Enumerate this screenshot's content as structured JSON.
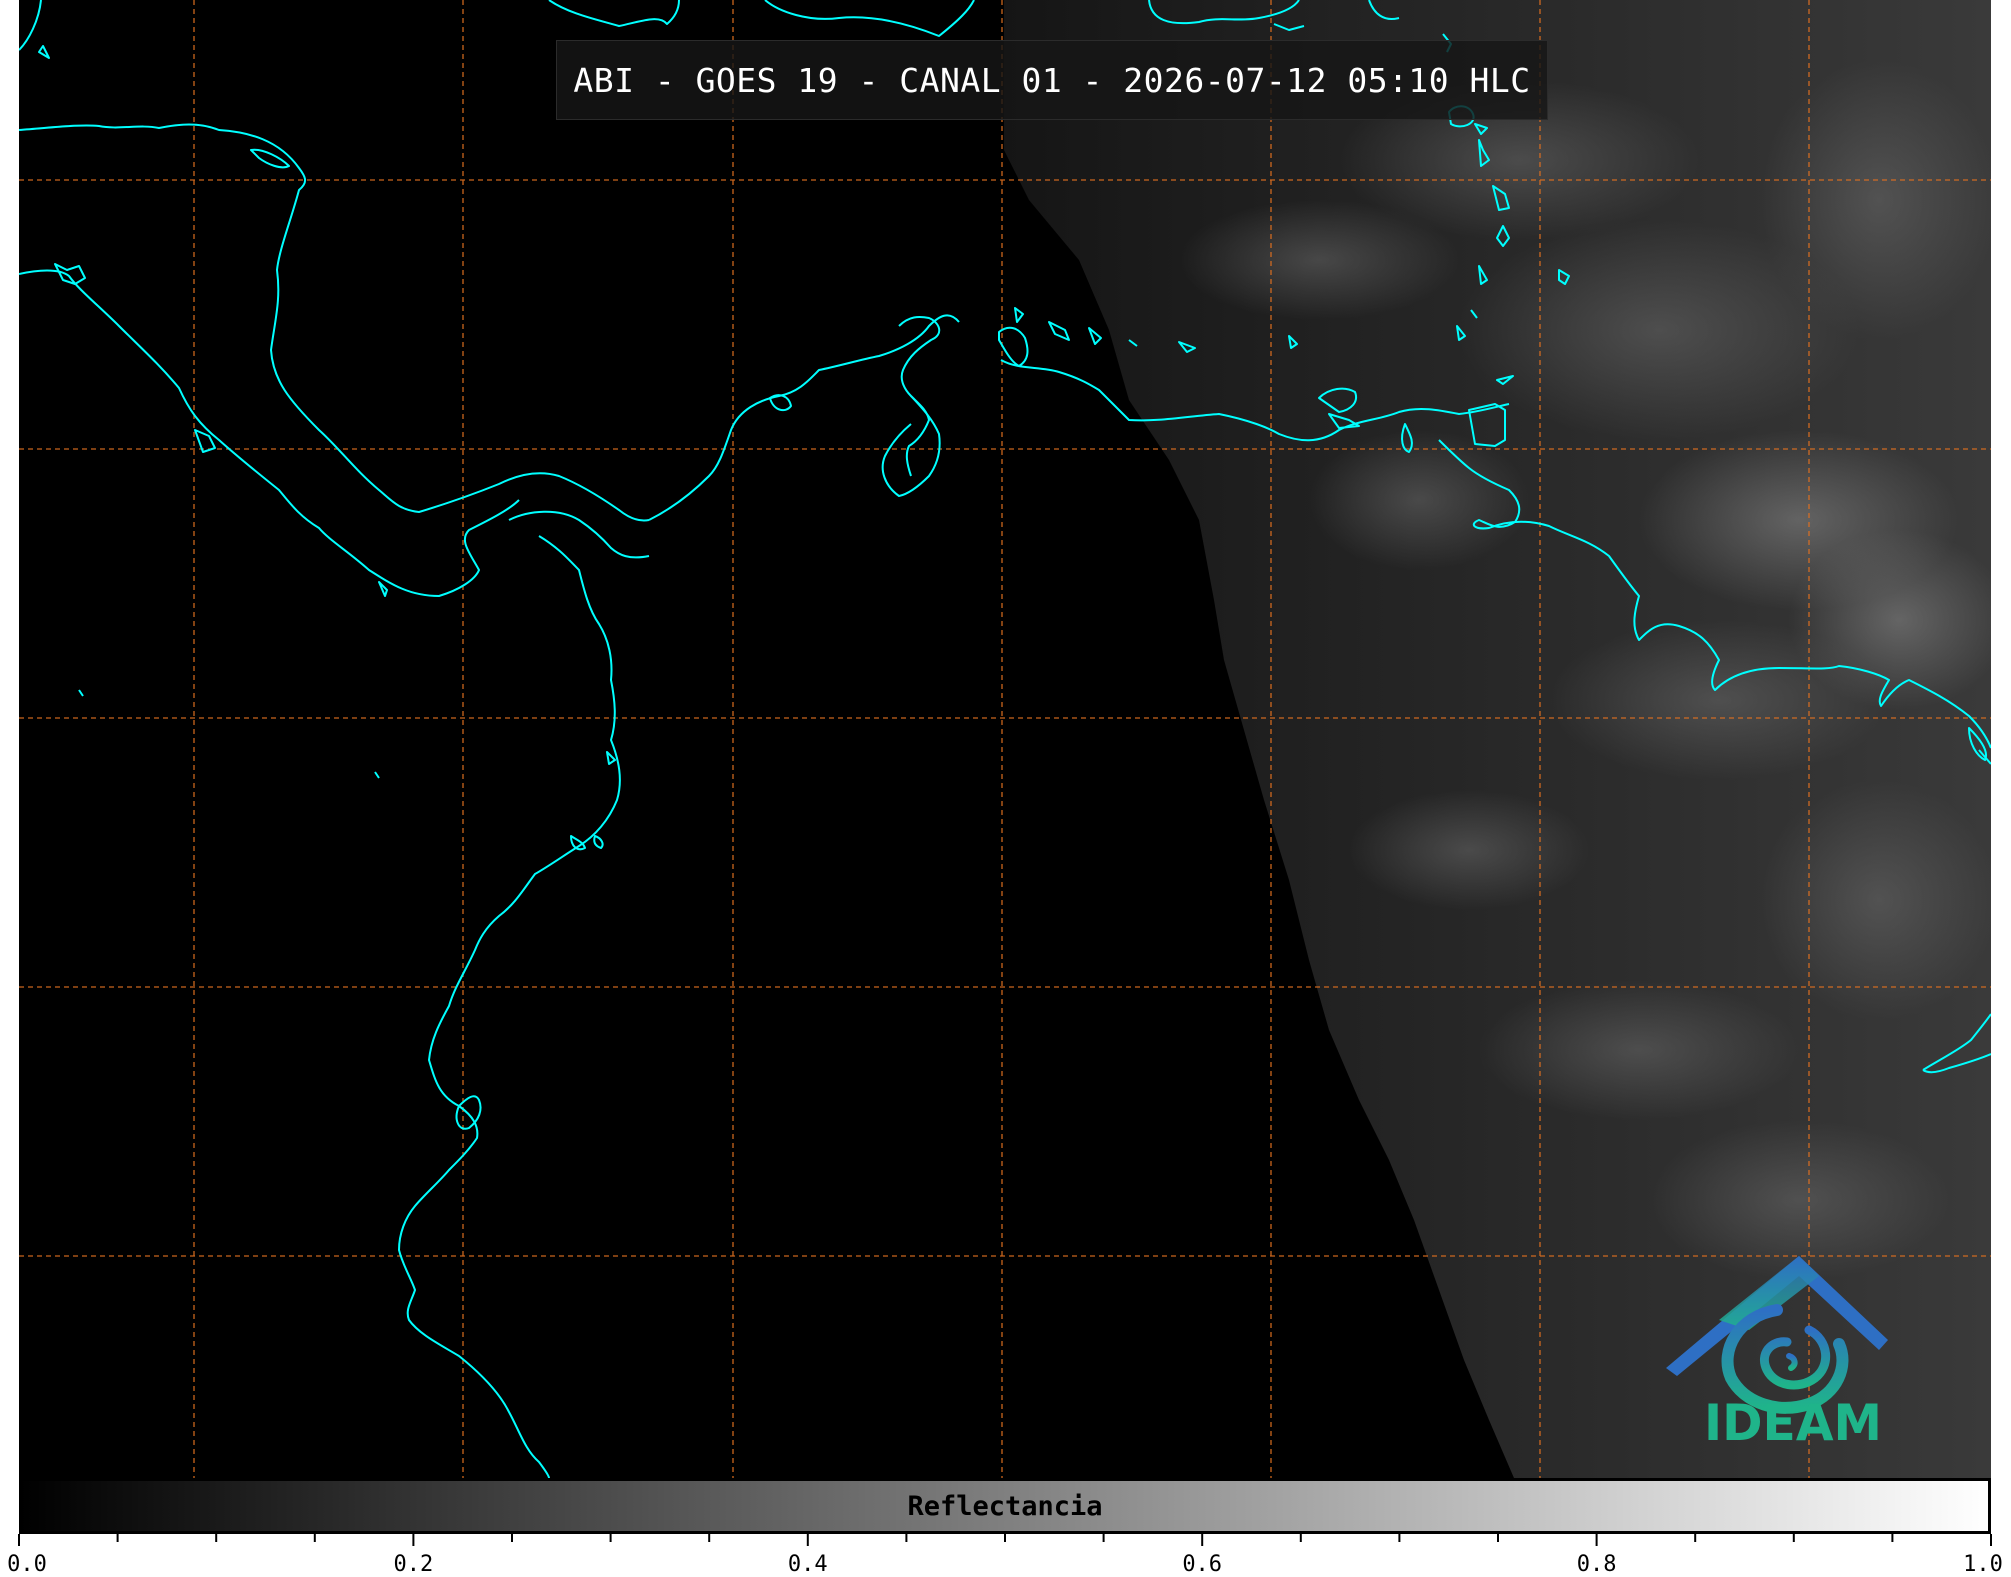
{
  "title": "ABI - GOES 19 - CANAL 01 - 2026-07-12 05:10 HLC",
  "colorbar": {
    "label": "Reflectancia",
    "ticks": [
      "0.0",
      "0.2",
      "0.4",
      "0.6",
      "0.8",
      "1.0"
    ],
    "min": 0.0,
    "max": 1.0,
    "gradient_from": "#000000",
    "gradient_to": "#ffffff"
  },
  "colors": {
    "coastline": "#00ffff",
    "gridline": "#e07020",
    "background": "#000000"
  },
  "logo": {
    "text": "IDEAM",
    "mountain_color": "#2e6fc4",
    "swirl_color": "#1fb48a",
    "text_color": "#1fb48a"
  }
}
